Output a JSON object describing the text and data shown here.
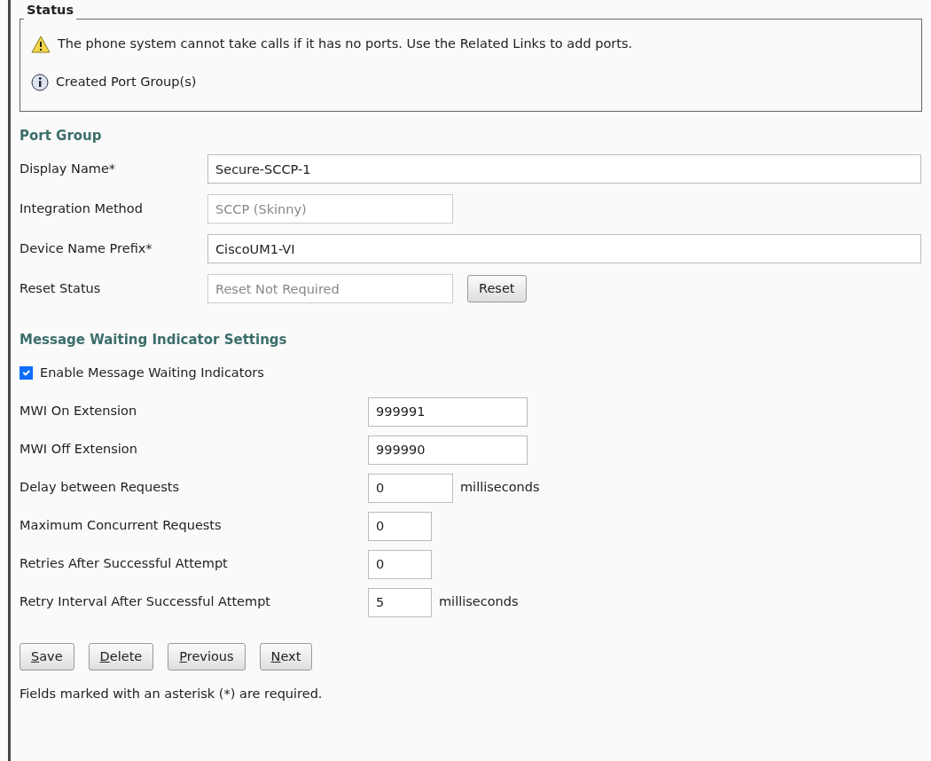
{
  "status": {
    "title": "Status",
    "messages": [
      {
        "kind": "warning",
        "text": "The phone system cannot take calls if it has no ports. Use the Related Links to add ports."
      },
      {
        "kind": "info",
        "text": "Created Port Group(s)"
      }
    ]
  },
  "port_group": {
    "title": "Port Group",
    "fields": [
      {
        "label": "Display Name*",
        "value": "Secure-SCCP-1",
        "disabled": false
      },
      {
        "label": "Integration Method",
        "value": "SCCP (Skinny)",
        "disabled": true
      },
      {
        "label": "Device Name Prefix*",
        "value": "CiscoUM1-VI",
        "disabled": false
      },
      {
        "label": "Reset Status",
        "value": "Reset Not Required",
        "disabled": true,
        "button": "Reset"
      }
    ]
  },
  "mwi": {
    "title": "Message Waiting Indicator Settings",
    "enable": {
      "label": "Enable Message Waiting Indicators",
      "checked": true
    },
    "fields": [
      {
        "label": "MWI On Extension",
        "value": "999991"
      },
      {
        "label": "MWI Off Extension",
        "value": "999990"
      },
      {
        "label": "Delay between Requests",
        "value": "0",
        "unit": "milliseconds"
      },
      {
        "label": "Maximum Concurrent Requests",
        "value": "0"
      },
      {
        "label": "Retries After Successful Attempt",
        "value": "0"
      },
      {
        "label": "Retry Interval After Successful Attempt",
        "value": "5",
        "unit": "milliseconds"
      }
    ]
  },
  "buttons": [
    {
      "label": "Save",
      "underline_first": true
    },
    {
      "label": "Delete",
      "underline_first": true
    },
    {
      "label": "Previous",
      "underline_first": true
    },
    {
      "label": "Next",
      "underline_first": true
    }
  ],
  "footer": "Fields marked with an asterisk (*) are required."
}
